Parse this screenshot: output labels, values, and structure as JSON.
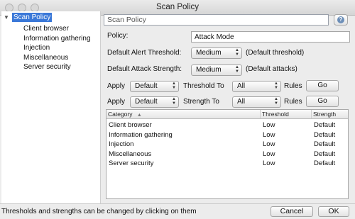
{
  "window": {
    "title": "Scan Policy"
  },
  "tree": {
    "root_label": "Scan Policy",
    "items": [
      {
        "label": "Client browser"
      },
      {
        "label": "Information gathering"
      },
      {
        "label": "Injection"
      },
      {
        "label": "Miscellaneous"
      },
      {
        "label": "Server security"
      }
    ]
  },
  "panel": {
    "header": "Scan Policy",
    "help_icon": "help-icon",
    "policy_label": "Policy:",
    "policy_value": "Attack Mode",
    "alert_threshold_label": "Default Alert Threshold:",
    "alert_threshold_value": "Medium",
    "alert_threshold_note": "(Default threshold)",
    "attack_strength_label": "Default Attack Strength:",
    "attack_strength_value": "Medium",
    "attack_strength_note": "(Default attacks)",
    "apply_threshold": {
      "apply_label": "Apply",
      "value": "Default",
      "to_label": "Threshold To",
      "target": "All",
      "rules_label": "Rules",
      "go_label": "Go"
    },
    "apply_strength": {
      "apply_label": "Apply",
      "value": "Default",
      "to_label": "Strength To",
      "target": "All",
      "rules_label": "Rules",
      "go_label": "Go"
    }
  },
  "table": {
    "columns": [
      "Category",
      "Threshold",
      "Strength"
    ],
    "rows": [
      [
        "Client browser",
        "Low",
        "Default"
      ],
      [
        "Information gathering",
        "Low",
        "Default"
      ],
      [
        "Injection",
        "Low",
        "Default"
      ],
      [
        "Miscellaneous",
        "Low",
        "Default"
      ],
      [
        "Server security",
        "Low",
        "Default"
      ]
    ]
  },
  "footer": {
    "status": "Thresholds and strengths can be changed by clicking on them",
    "cancel_label": "Cancel",
    "ok_label": "OK"
  }
}
